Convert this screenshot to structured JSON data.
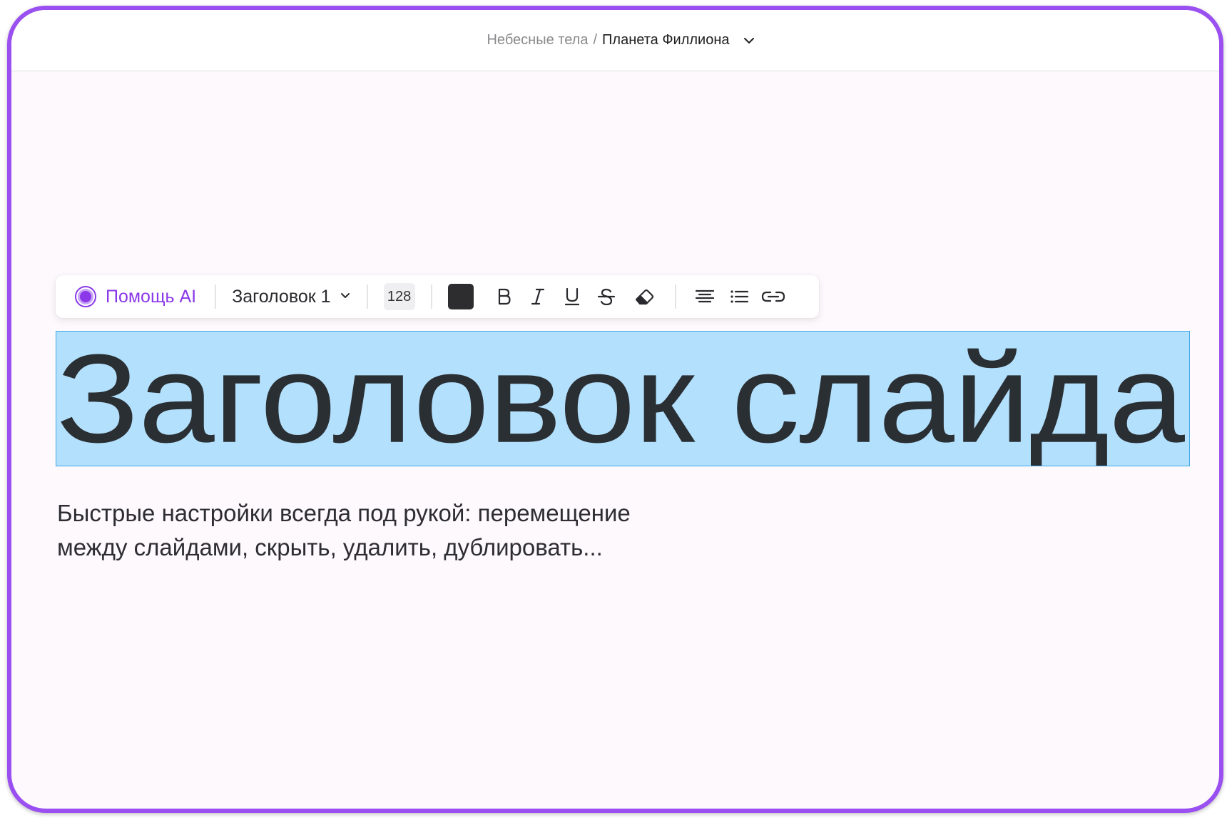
{
  "breadcrumb": {
    "parent": "Небесные тела",
    "separator": "/",
    "current": "Планета Филлиона"
  },
  "toolbar": {
    "ai_label": "Помощь AI",
    "text_style": "Заголовок 1",
    "font_size": "128",
    "text_color": "#2d2d2f"
  },
  "slide": {
    "heading": "Заголовок слайда",
    "subtitle_line1": "Быстрые настройки всегда под рукой: перемещение",
    "subtitle_line2": "между слайдами, скрыть, удалить, дублировать..."
  },
  "colors": {
    "accent": "#9a4ff0",
    "selection": "#b3e0fd",
    "ai": "#8a38e8"
  }
}
